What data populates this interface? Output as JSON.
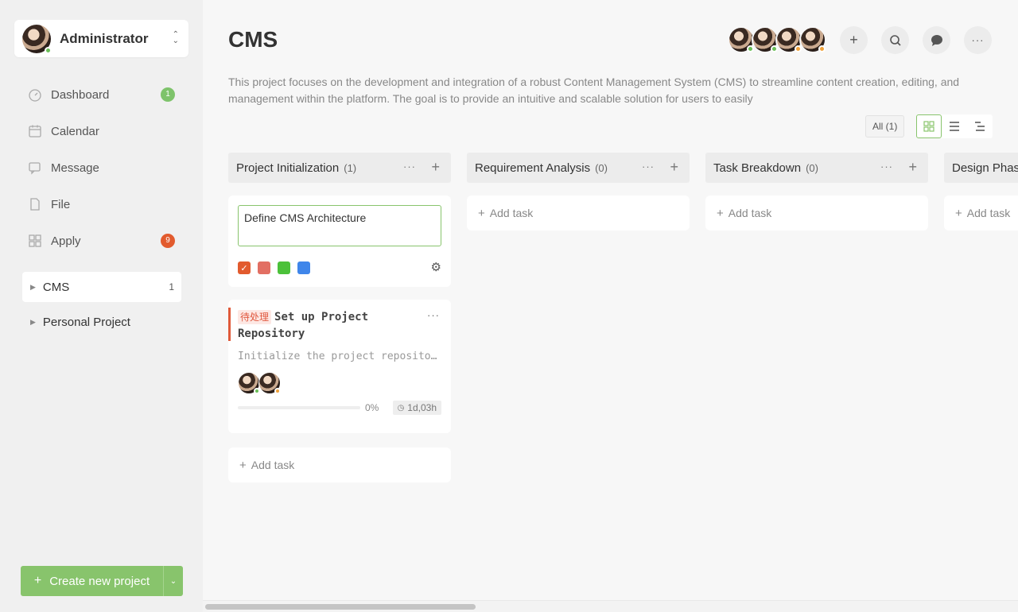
{
  "account": {
    "name": "Administrator",
    "status_color": "#6bbf59"
  },
  "nav": [
    {
      "label": "Dashboard",
      "icon": "dashboard-icon",
      "badge": "1",
      "badge_color": "#7ec36b"
    },
    {
      "label": "Calendar",
      "icon": "calendar-icon"
    },
    {
      "label": "Message",
      "icon": "message-icon"
    },
    {
      "label": "File",
      "icon": "file-icon"
    },
    {
      "label": "Apply",
      "icon": "apply-icon",
      "badge": "9",
      "badge_color": "#e25b2e"
    }
  ],
  "projects": [
    {
      "label": "CMS",
      "count": "1",
      "active": true
    },
    {
      "label": "Personal Project"
    }
  ],
  "create_button": {
    "label": "Create new project"
  },
  "header": {
    "title": "CMS",
    "description": "This project focuses on the development and integration of a robust Content Management System (CMS) to streamline content creation, editing, and management within the platform. The goal is to provide an intuitive and scalable solution for users to easily",
    "member_status_colors": [
      "#6bbf59",
      "#6bbf59",
      "#f0a23b",
      "#f0a23b"
    ]
  },
  "filter": {
    "label": "All (1)"
  },
  "accent_color": "#88c46c",
  "columns": [
    {
      "title": "Project Initialization",
      "count": "(1)"
    },
    {
      "title": "Requirement Analysis",
      "count": "(0)"
    },
    {
      "title": "Task Breakdown",
      "count": "(0)"
    },
    {
      "title": "Design Phase",
      "count": ""
    }
  ],
  "add_task_label": "Add task",
  "new_task": {
    "value": "Define CMS Architecture",
    "swatches": [
      "#e25b2e",
      "#e26f63",
      "#4cc13a",
      "#3f86ea"
    ]
  },
  "task": {
    "tag": "待处理",
    "title": "Set up Project Repository",
    "description": "Initialize the project repository",
    "progress": 0,
    "progress_text": "0%",
    "duration": "1d,03h",
    "assignee_status_colors": [
      "#6bbf59",
      "#f0a23b"
    ]
  }
}
